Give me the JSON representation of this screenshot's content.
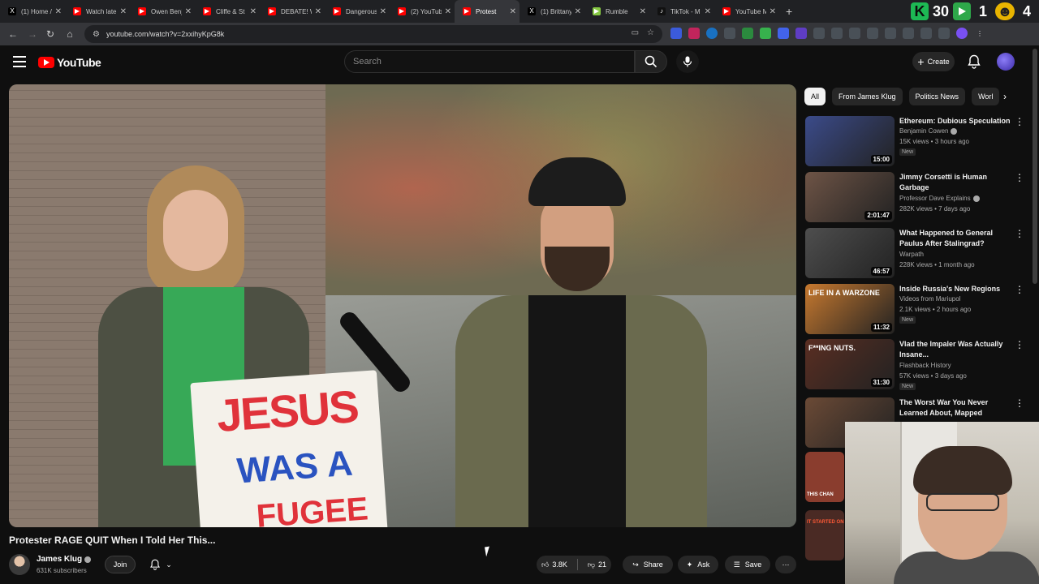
{
  "browser": {
    "tabs": [
      {
        "label": "(1) Home /",
        "fav_color": "#000000",
        "fav_glyph": "X"
      },
      {
        "label": "Watch late",
        "fav_color": "#ff0000",
        "fav_glyph": "▶"
      },
      {
        "label": "Owen Benj",
        "fav_color": "#ff0000",
        "fav_glyph": "▶"
      },
      {
        "label": "Cliffe & St",
        "fav_color": "#ff0000",
        "fav_glyph": "▶"
      },
      {
        "label": "DEBATE! W",
        "fav_color": "#ff0000",
        "fav_glyph": "▶"
      },
      {
        "label": "Dangerous",
        "fav_color": "#ff0000",
        "fav_glyph": "▶"
      },
      {
        "label": "(2) YouTub",
        "fav_color": "#ff0000",
        "fav_glyph": "▶"
      },
      {
        "label": "Protest",
        "fav_color": "#ff0000",
        "fav_glyph": "▶",
        "active": true
      },
      {
        "label": "(1) Brittany",
        "fav_color": "#000000",
        "fav_glyph": "X"
      },
      {
        "label": "Rumble",
        "fav_color": "#85c742",
        "fav_glyph": "▶"
      },
      {
        "label": "TikTok - M",
        "fav_color": "#111111",
        "fav_glyph": "♪"
      },
      {
        "label": "YouTube M",
        "fav_color": "#ff0000",
        "fav_glyph": "▶"
      }
    ],
    "new_tab": "+",
    "sys": {
      "k": "K",
      "n1": "30",
      "n2": "1",
      "n3": "4"
    },
    "url": "youtube.com/watch?v=2xxihyKpG8k"
  },
  "yt": {
    "logo_text": "YouTube",
    "search_placeholder": "Search",
    "create_label": "Create"
  },
  "video": {
    "sign": {
      "l1": "JESUS",
      "l2": "WAS A",
      "l3": "FUGEE"
    },
    "title": "Protester RAGE QUIT When I Told Her This...",
    "channel": "James Klug",
    "subscribers": "631K subscribers",
    "join_label": "Join",
    "likes": "3.8K",
    "dislikes": "21",
    "share_label": "Share",
    "ask_label": "Ask",
    "save_label": "Save"
  },
  "sidebar": {
    "chips": [
      "All",
      "From James Klug",
      "Politics News",
      "Worl"
    ],
    "recs": [
      {
        "title": "Ethereum: Dubious Speculation",
        "channel": "Benjamin Cowen",
        "verified": true,
        "meta": "15K views • 3 hours ago",
        "duration": "15:00",
        "new": "New",
        "thumb": "#3b4b8a"
      },
      {
        "title": "Jimmy Corsetti is Human Garbage",
        "channel": "Professor Dave Explains",
        "verified": true,
        "meta": "282K views • 7 days ago",
        "duration": "2:01:47",
        "new": "",
        "thumb": "#6e5446"
      },
      {
        "title": "What Happened to General Paulus After Stalingrad?",
        "channel": "Warpath",
        "verified": false,
        "meta": "228K views • 1 month ago",
        "duration": "46:57",
        "new": "",
        "thumb": "#4e4e4e"
      },
      {
        "title": "Inside Russia's New Regions",
        "channel": "Videos from Mariupol",
        "verified": false,
        "meta": "2.1K views • 2 hours ago",
        "duration": "11:32",
        "new": "New",
        "thumb": "#c7792f",
        "overlay": "LIFE IN A WARZONE"
      },
      {
        "title": "Vlad the Impaler Was Actually Insane...",
        "channel": "Flashback History",
        "verified": false,
        "meta": "57K views • 3 days ago",
        "duration": "31:30",
        "new": "New",
        "thumb": "#5a2e22",
        "overlay": "F**ING NUTS."
      },
      {
        "title": "The Worst War You Never Learned About, Mapped",
        "channel": "",
        "verified": false,
        "meta": "",
        "duration": "",
        "new": "",
        "thumb": "#6b4a36"
      }
    ],
    "under_overlays": [
      "THIS CHAN",
      "IT STARTED ON"
    ]
  }
}
